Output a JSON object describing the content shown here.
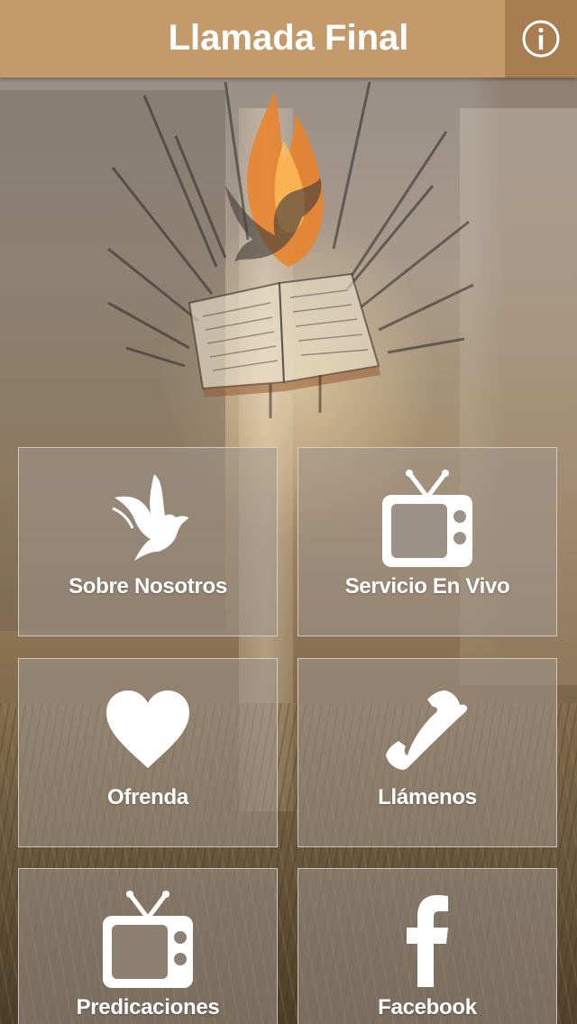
{
  "header": {
    "title": "Llamada Final",
    "info_icon": "info-circle-icon"
  },
  "tiles": [
    {
      "label": "Sobre Nosotros",
      "icon": "dove-icon"
    },
    {
      "label": "Servicio En Vivo",
      "icon": "tv-icon"
    },
    {
      "label": "Ofrenda",
      "icon": "heart-icon"
    },
    {
      "label": "Llámenos",
      "icon": "phone-icon"
    },
    {
      "label": "Predicaciones",
      "icon": "tv-icon"
    },
    {
      "label": "Facebook",
      "icon": "facebook-icon"
    }
  ],
  "colors": {
    "header_bg": "#c59a6a",
    "info_button_bg": "#a87d50",
    "tile_bg": "rgba(160,150,140,0.55)",
    "text": "#ffffff"
  }
}
